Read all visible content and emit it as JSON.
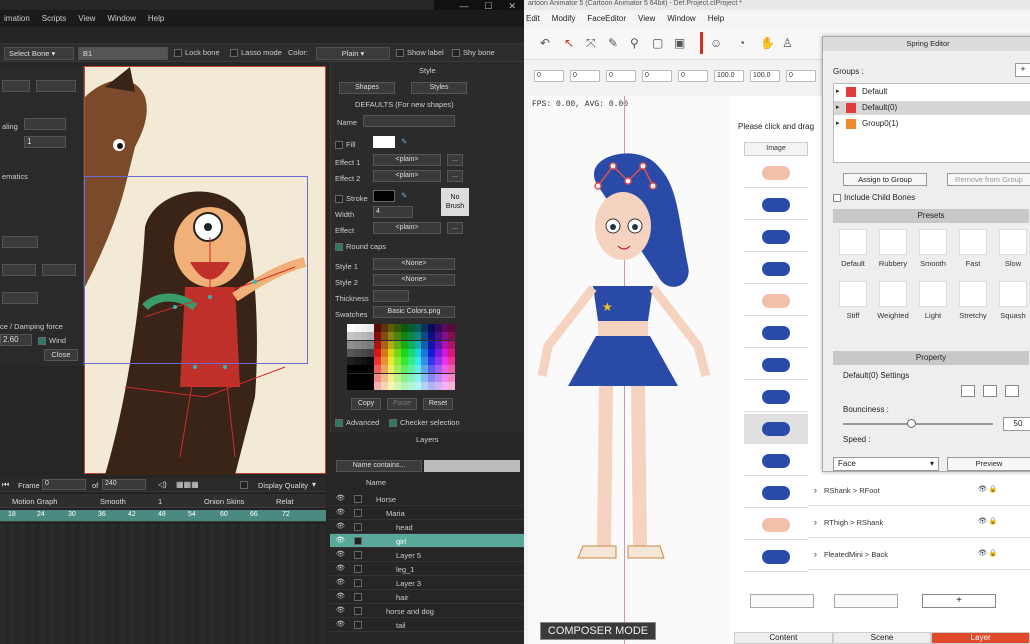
{
  "left_app": {
    "menu": [
      "imation",
      "Scripts",
      "View",
      "Window",
      "Help"
    ],
    "window_controls": [
      "—",
      "☐",
      "✕"
    ],
    "toolbar": {
      "select_bone": "Select Bone",
      "bone_name": "B1",
      "lock_bone": "Lock bone",
      "lasso_mode": "Lasso mode",
      "color_label": "Color:",
      "color_value": "Plain",
      "show_label": "Show label",
      "shy_bone": "Shy bone"
    },
    "kinematics_dialog": {
      "scaling": "aling",
      "value_1": "1",
      "ematics": "ematics",
      "damping": "ce / Damping force",
      "value_260": "2.60",
      "wind": "Wind",
      "close": "Close"
    },
    "style_panel": {
      "title": "Style",
      "shapes": "Shapes",
      "styles": "Styles",
      "defaults": "DEFAULTS (For new shapes)",
      "name": "Name",
      "fill": "Fill",
      "effect1": "Effect 1",
      "effect1_value": "<plain>",
      "effect2": "Effect 2",
      "effect2_value": "<plain>",
      "stroke": "Stroke",
      "no_brush": "No Brush",
      "width": "Width",
      "width_value": "4",
      "effect": "Effect",
      "effect_value": "<plain>",
      "round_caps": "Round caps",
      "style1": "Style 1",
      "style1_value": "<None>",
      "style2": "Style 2",
      "style2_value": "<None>",
      "thickness": "Thickness",
      "swatches": "Swatches",
      "swatches_value": "Basic Colors.png",
      "copy": "Copy",
      "paste": "Paste",
      "reset": "Reset",
      "advanced": "Advanced",
      "checker": "Checker selection"
    },
    "layers_panel": {
      "title": "Layers",
      "filter": "Name contains...",
      "col_name": "Name",
      "items": [
        {
          "name": "Horse",
          "indent": 1
        },
        {
          "name": "Maria",
          "indent": 2
        },
        {
          "name": "head",
          "indent": 3
        },
        {
          "name": "girl",
          "indent": 3
        },
        {
          "name": "Layer 5",
          "indent": 3
        },
        {
          "name": "leg_1",
          "indent": 3
        },
        {
          "name": "Layer 3",
          "indent": 3
        },
        {
          "name": "hair",
          "indent": 3
        },
        {
          "name": "horse and dog",
          "indent": 2
        },
        {
          "name": "tail",
          "indent": 3
        }
      ],
      "selected": "girl"
    },
    "timeline": {
      "frame_label": "Frame",
      "frame_value": "0",
      "of_label": "of",
      "total": "240",
      "display_quality": "Display Quality",
      "motion_graph": "Motion Graph",
      "smooth": "Smooth",
      "smooth_value": "1",
      "onion_skins": "Onion Skins",
      "relat": "Relat",
      "ticks": [
        "18",
        "24",
        "30",
        "36",
        "42",
        "48",
        "54",
        "60",
        "66",
        "72"
      ]
    }
  },
  "right_app": {
    "title": "artoon Animator 5 (Cartoon Animator 5 64bit) - Def.Project.ctProject *",
    "menu": [
      "Edit",
      "Modify",
      "FaceEditor",
      "View",
      "Window",
      "Help"
    ],
    "coords": [
      "0",
      "0",
      "0",
      "0",
      "0",
      "100.0",
      "100.0",
      "0"
    ],
    "fps": "FPS: 0.00, AVG: 0.00",
    "content_hint": "Please click and drag",
    "image_header": "Image",
    "composer_mode": "COMPOSER MODE",
    "bone_rows": [
      "RShank > RFoot",
      "RThigh > RShank",
      "FleatedMini > Back"
    ],
    "tabs": [
      "Content",
      "Scene",
      "Layer"
    ],
    "active_tab": "Layer",
    "add_button": "+",
    "spring_editor": {
      "title": "Spring Editor",
      "groups_label": "Groups :",
      "groups": [
        {
          "name": "Default",
          "color": "#e03c3c"
        },
        {
          "name": "Default(0)",
          "color": "#e03c3c"
        },
        {
          "name": "Group0(1)",
          "color": "#f08a2a"
        }
      ],
      "selected_group": "Default(0)",
      "assign": "Assign to Group",
      "remove": "Remove from Group",
      "include_child": "Include Child Bones",
      "presets_title": "Presets",
      "presets": [
        "Default",
        "Rubbery",
        "Smooth",
        "Fast",
        "Slow",
        "Stiff",
        "Weighted",
        "Light",
        "Stretchy",
        "Squash"
      ],
      "property_title": "Property",
      "settings_label": "Default(0) Settings",
      "bounciness": "Bounciness :",
      "bounciness_value": "50",
      "bounciness_level": 0.45,
      "speed": "Speed :",
      "face": "Face",
      "preview": "Preview"
    }
  },
  "colors": {
    "accent": "#5aa89a",
    "brand_red": "#e04a2a",
    "selection_red": "#e03c3c"
  }
}
